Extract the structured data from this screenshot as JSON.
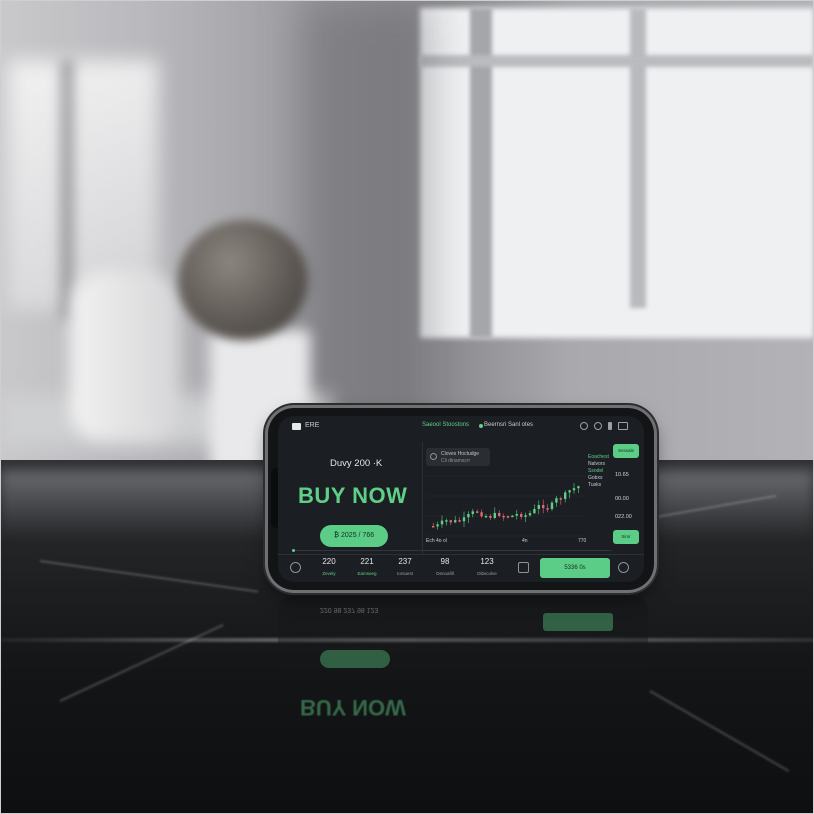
{
  "app": {
    "name": "ERE",
    "tabs": [
      "Saeool Stoostons",
      "Beernsri Sanl otes"
    ]
  },
  "promo": {
    "subtitle": "Duvy 200 ·K",
    "headline": "BUY NOW",
    "button_label": "₿ 2025 / 766"
  },
  "info_card": {
    "line1": "Cloves Hoctudge",
    "line2": "Cli dinamscrr"
  },
  "chart_labels": {
    "top_right_1": "Eoachest",
    "top_right_2": "Nalvors",
    "side_1": "Ssodel",
    "side_2": "Gobxs",
    "side_3": "Tusks",
    "bottom_1": "Ech 4o ol",
    "bottom_2": "4n",
    "bottom_3": "770"
  },
  "right_column": {
    "top_button": "Sessale",
    "values": [
      "10.65",
      "00.00",
      "022.00"
    ],
    "bottom_button": "Sirsr"
  },
  "bottom_bar": {
    "stats": [
      {
        "value": "220",
        "label": "Zevely",
        "active": true
      },
      {
        "value": "221",
        "label": "Eamseeg",
        "active": true
      },
      {
        "value": "237",
        "label": "Iorsuest",
        "active": false
      },
      {
        "value": "98",
        "label": "Denoafill",
        "active": false
      },
      {
        "value": "123",
        "label": "Dibscolve",
        "active": false
      }
    ],
    "action_button": "5336 0s"
  },
  "reflection": {
    "headline": "BUY NOW",
    "row": "220   98   237   98   123"
  },
  "colors": {
    "accent": "#5fcf87",
    "screen_bg": "#1b1e22",
    "candle_up": "#5fcf87",
    "candle_down": "#e06a70"
  },
  "icons": [
    "app-logo-icon",
    "search-icon",
    "settings-icon",
    "wallet-icon",
    "home-icon",
    "chat-icon",
    "menu-icon"
  ]
}
